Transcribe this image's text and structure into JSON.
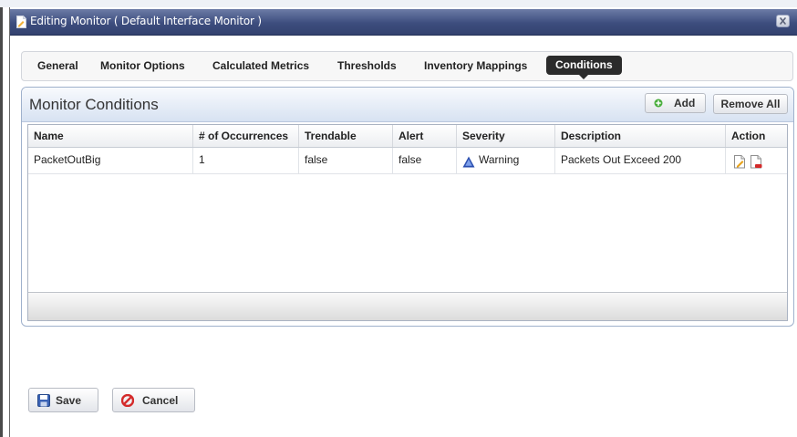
{
  "window": {
    "title": "Editing Monitor ( Default Interface Monitor )"
  },
  "tabs": [
    {
      "label": "General"
    },
    {
      "label": "Monitor Options"
    },
    {
      "label": "Calculated Metrics"
    },
    {
      "label": "Thresholds"
    },
    {
      "label": "Inventory Mappings"
    },
    {
      "label": "Conditions",
      "active": true
    }
  ],
  "panel": {
    "title": "Monitor Conditions",
    "add_label": "Add",
    "remove_all_label": "Remove All"
  },
  "grid": {
    "columns": [
      "Name",
      "# of Occurrences",
      "Trendable",
      "Alert",
      "Severity",
      "Description",
      "Action"
    ],
    "rows": [
      {
        "name": "PacketOutBig",
        "occurrences": "1",
        "trendable": "false",
        "alert": "false",
        "severity": "Warning",
        "description": "Packets Out Exceed 200",
        "actions": [
          "edit-icon",
          "delete-icon"
        ]
      }
    ]
  },
  "footer": {
    "save_label": "Save",
    "cancel_label": "Cancel"
  },
  "colors": {
    "titlebar": "#3d4d7e",
    "panel_header": "#d7e2f2",
    "active_tab": "#2b2b2b",
    "warning_icon": "#2b4fb0"
  }
}
